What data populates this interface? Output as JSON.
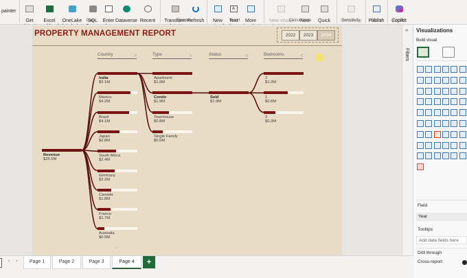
{
  "ribbon": {
    "painter": "painter",
    "buttons": [
      {
        "label": "Get\ndata ˅",
        "disabled": false
      },
      {
        "label": "Excel\nworkbook",
        "disabled": false
      },
      {
        "label": "OneLake\ndata hub ˅",
        "disabled": false
      },
      {
        "label": "SQL\nServer",
        "disabled": false
      },
      {
        "label": "Enter\ndata",
        "disabled": false
      },
      {
        "label": "Dataverse",
        "disabled": false
      },
      {
        "label": "Recent\nsources ˅",
        "disabled": false
      },
      {
        "label": "Transform\ndata ˅",
        "disabled": false
      },
      {
        "label": "Refresh",
        "disabled": false
      },
      {
        "label": "New\nvisual",
        "disabled": false
      },
      {
        "label": "Text\nbox",
        "disabled": false
      },
      {
        "label": "More\nvisuals ˅",
        "disabled": false
      },
      {
        "label": "New visual\ncalculation ˅",
        "disabled": true
      },
      {
        "label": "New\nmeasure",
        "disabled": false
      },
      {
        "label": "Quick\nmeasure",
        "disabled": false
      },
      {
        "label": "Sensitivity\n˅",
        "disabled": true
      },
      {
        "label": "Publish",
        "disabled": false
      },
      {
        "label": "Copilot",
        "disabled": false
      }
    ],
    "groups": [
      "Data",
      "Queries",
      "Insert",
      "Calculations",
      "Sensitivity",
      "Share",
      "Copilot"
    ]
  },
  "report": {
    "title": "PROPERTY MANAGEMENT REPORT",
    "years": [
      "2022",
      "2023",
      "2024"
    ],
    "selected_year": "2024"
  },
  "tree": {
    "columns": [
      "Country",
      "Type",
      "Status",
      "Bedrooms"
    ],
    "root": {
      "label": "Revenue",
      "value": "$25.5M"
    },
    "countries": [
      {
        "label": "India",
        "value": "$5.1M",
        "fill": 1.0,
        "expanded": true
      },
      {
        "label": "Mexico",
        "value": "$4.2M",
        "fill": 0.82,
        "expanded": false
      },
      {
        "label": "Brasil",
        "value": "$4.1M",
        "fill": 0.8,
        "expanded": false
      },
      {
        "label": "Japan",
        "value": "$2.8M",
        "fill": 0.55,
        "expanded": false
      },
      {
        "label": "South Africa",
        "value": "$2.4M",
        "fill": 0.47,
        "expanded": false
      },
      {
        "label": "Germany",
        "value": "$2.2M",
        "fill": 0.43,
        "expanded": false
      },
      {
        "label": "Canada",
        "value": "$1.8M",
        "fill": 0.35,
        "expanded": false
      },
      {
        "label": "France",
        "value": "$1.7M",
        "fill": 0.33,
        "expanded": false
      },
      {
        "label": "Australia",
        "value": "$0.9M",
        "fill": 0.18,
        "expanded": false
      }
    ],
    "types": [
      {
        "label": "Apartment",
        "value": "$1.9M",
        "fill": 1.0,
        "expanded": false
      },
      {
        "label": "Condo",
        "value": "$1.9M",
        "fill": 1.0,
        "expanded": true
      },
      {
        "label": "Townhouse",
        "value": "$0.8M",
        "fill": 0.42,
        "expanded": false
      },
      {
        "label": "Single Family",
        "value": "$0.5M",
        "fill": 0.26,
        "expanded": false
      }
    ],
    "statuses": [
      {
        "label": "Sold",
        "value": "$1.9M",
        "fill": 1.0,
        "expanded": true
      }
    ],
    "bedrooms": [
      {
        "label": "2",
        "value": "$1.0M",
        "fill": 1.0,
        "expanded": false
      },
      {
        "label": "1",
        "value": "$0.6M",
        "fill": 0.6,
        "expanded": false
      },
      {
        "label": "3",
        "value": "$0.3M",
        "fill": 0.3,
        "expanded": false
      }
    ]
  },
  "filters_pane": {
    "label": "Filters"
  },
  "viz_pane": {
    "title": "Visualizations",
    "subtitle": "Build visual",
    "field_label": "Field",
    "field_value": "Year",
    "tooltips_label": "Tooltips",
    "tooltips_hint": "Add data fields here",
    "drill_label": "Drill through",
    "cross_report_label": "Cross-report"
  },
  "pages": {
    "tabs": [
      "Page 1",
      "Page 2",
      "Page 3",
      "Page 4"
    ],
    "active": "Page 4",
    "add_label": "+"
  },
  "colors": {
    "bar": "#7a1414",
    "track": "#fbf6ec",
    "report_bg": "#e8dcc6",
    "title": "#8a1a1a",
    "link": "#5a1212",
    "add_page": "#1f6b3a"
  }
}
